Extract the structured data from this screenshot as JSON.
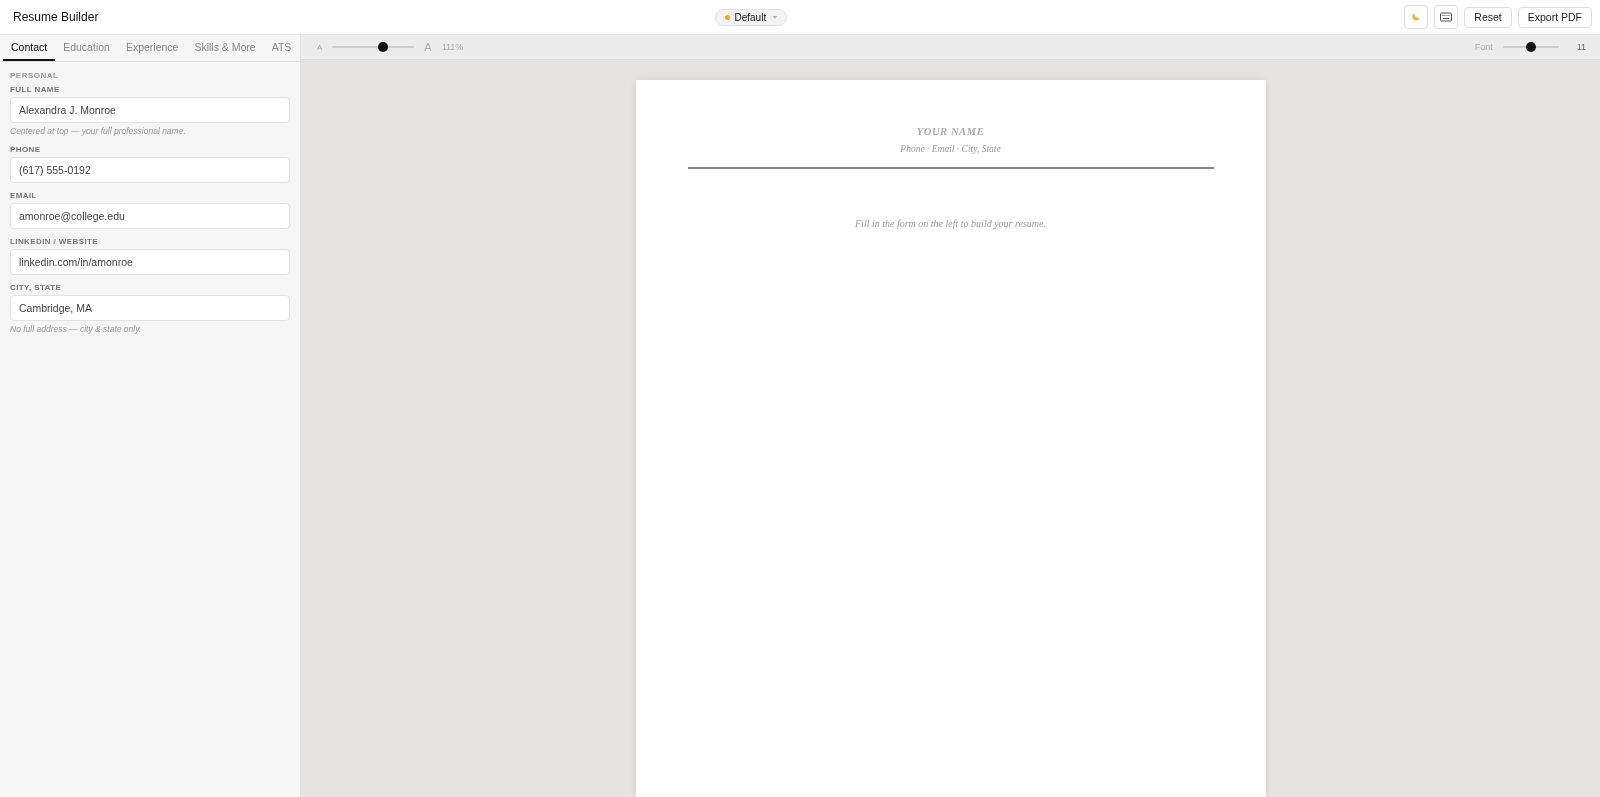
{
  "app": {
    "title": "Resume Builder"
  },
  "template": {
    "label": "Default",
    "color": "#f5a623"
  },
  "actions": [
    "Reset",
    "Export PDF"
  ],
  "tabs": [
    {
      "label": "Contact",
      "selected": true
    },
    {
      "label": "Education",
      "selected": false
    },
    {
      "label": "Experience",
      "selected": false
    },
    {
      "label": "Skills & More",
      "selected": false
    },
    {
      "label": "ATS",
      "selected": false
    }
  ],
  "form": {
    "section": "PERSONAL",
    "fields": [
      {
        "label": "FULL NAME",
        "value": "Alexandra J. Monroe",
        "hint": "Centered at top — your full professional name."
      },
      {
        "label": "PHONE",
        "value": "(617) 555-0192"
      },
      {
        "label": "EMAIL",
        "value": "amonroe@college.edu"
      },
      {
        "label": "LINKEDIN / WEBSITE",
        "value": "linkedin.com/in/amonroe"
      },
      {
        "label": "CITY, STATE",
        "value": "Cambridge, MA",
        "hint": "No full address — city & state only."
      }
    ]
  },
  "zoom": {
    "small_label": "A",
    "large_label": "A",
    "level": 0.62,
    "reading": "111%"
  },
  "font": {
    "label": "Font",
    "level": 0.5,
    "reading": "11"
  },
  "resume": {
    "name": "YOUR NAME",
    "contact": "Phone · Email · City, State",
    "empty_message": "Fill in the form on the left to build your resume."
  }
}
